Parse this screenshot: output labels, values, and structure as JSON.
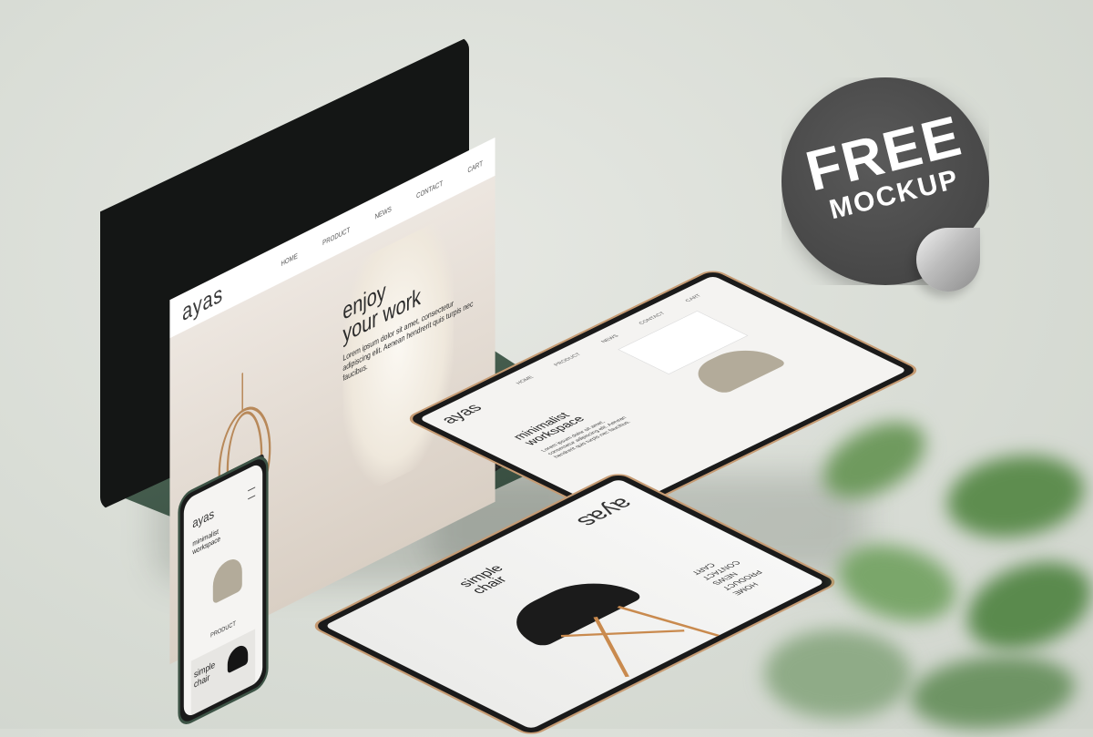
{
  "laptop": {
    "logo": "ayas",
    "nav": [
      "HOME",
      "PRODUCT",
      "NEWS",
      "CONTACT",
      "CART"
    ],
    "hero_title_1": "enjoy",
    "hero_title_2": "your work",
    "hero_body": "Lorem ipsum dolor sit amet, consectetur adipiscing elit. Aenean hendrerit quis turpis nec faucibus."
  },
  "tablet_back": {
    "logo": "ayas",
    "nav": [
      "HOME",
      "PRODUCT",
      "NEWS",
      "CONTACT",
      "CART"
    ],
    "title_1": "minimalist",
    "title_2": "workspace",
    "body": "Lorem ipsum dolor sit amet, consectetur adipiscing elit. Aenean hendrerit quis turpis nec faucibus."
  },
  "tablet_front": {
    "logo": "ayas",
    "title_1": "simple",
    "title_2": "chair",
    "menu": [
      "HOME",
      "PRODUCT",
      "NEWS",
      "CONTACT",
      "CART"
    ]
  },
  "phone": {
    "logo": "ayas",
    "title_1": "minimalist",
    "title_2": "workspace",
    "product_label": "PRODUCT",
    "card_title_1": "simple",
    "card_title_2": "chair"
  },
  "sticker": {
    "line1": "FREE",
    "line2": "MOCKUP"
  },
  "colors": {
    "background": "#dadfd8",
    "laptop_body": "#3d5446",
    "tablet_trim": "#c69b73",
    "sticker": "#4a4a4a"
  }
}
